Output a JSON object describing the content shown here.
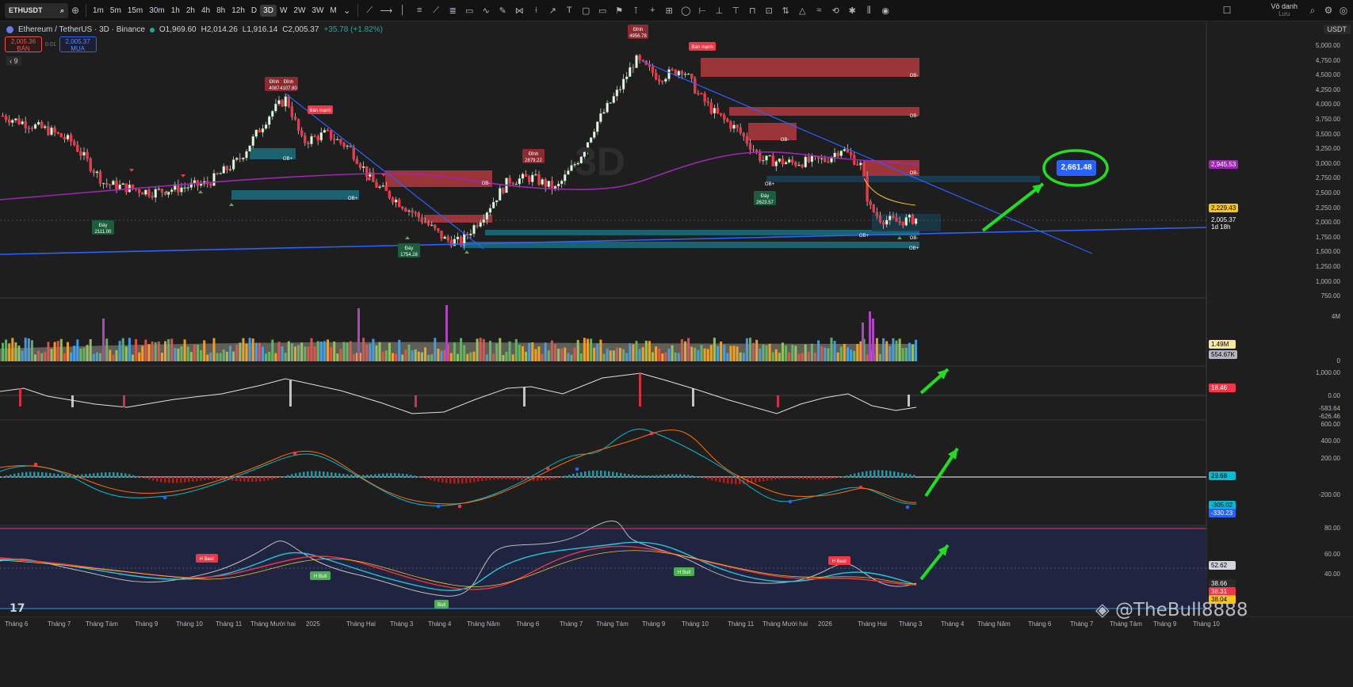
{
  "toolbar": {
    "symbol": "ETHUSDT",
    "intervals": [
      "1m",
      "5m",
      "15m",
      "30m",
      "1h",
      "2h",
      "4h",
      "8h",
      "12h",
      "D",
      "3D",
      "W",
      "2W",
      "3W",
      "M"
    ],
    "active_interval": "3D",
    "layout_name": "Vô danh",
    "layout_sub": "Lưu"
  },
  "legend": {
    "title": "Ethereum / TetherUS · 3D · Binance",
    "open": "O1,969.60",
    "high": "H2,014.26",
    "low": "L1,916.14",
    "close": "C2,005.37",
    "change": "+35.78 (+1.82%)"
  },
  "bidask": {
    "sell_price": "2,005.36",
    "sell_label": "BÁN",
    "spread": "0.01",
    "buy_price": "2,005.37",
    "buy_label": "MUA"
  },
  "indicator_count": "9",
  "currency": "USDT",
  "timeframe_watermark": "3D",
  "target_price": "2,661.48",
  "price_scale": [
    "5,000.00",
    "4,750.00",
    "4,500.00",
    "4,250.00",
    "4,000.00",
    "3,750.00",
    "3,500.00",
    "3,250.00",
    "3,000.00",
    "2,750.00",
    "2,500.00",
    "2,250.00",
    "2,000.00",
    "1,750.00",
    "1,500.00",
    "1,250.00",
    "1,000.00",
    "750.00"
  ],
  "price_tags": {
    "ma": "2,945.53",
    "ema": "2,229.43",
    "last": "2,005.37",
    "countdown": "1d 18h"
  },
  "volume_scale": [
    "4M",
    "0"
  ],
  "volume_tags": [
    "1.49M",
    "554.67K"
  ],
  "osc1_scale": [
    "1,000.00",
    "0.00",
    "-583.64",
    "-626.46"
  ],
  "osc1_tag": "18.46",
  "macd_scale": [
    "600.00",
    "400.00",
    "200.00",
    "-200.00",
    "-305.02",
    "-330.23"
  ],
  "macd_tag": "29.68",
  "rsi_scale": [
    "80.00",
    "60.00",
    "52.62",
    "40.00",
    "38.66",
    "38.31",
    "38.04"
  ],
  "chart_labels": {
    "peak1": "Đỉnh\n4087",
    "peak2": "Đỉnh\n4107.80",
    "peak3": "Đỉnh\n4956.78",
    "peak4": "Đỉnh\n2879.22",
    "trough1": "Đáy\n2111.00",
    "trough2": "Đáy\n1754.28",
    "trough3": "Đáy\n2623.57",
    "strong_sell": "Bán mạnh",
    "ob_bull": "OB+",
    "ob_bear": "OB-",
    "h_bear": "H Bear",
    "h_bull": "H Bull",
    "bull": "Bull"
  },
  "months": [
    "Tháng 6",
    "Tháng 7",
    "Tháng Tám",
    "Tháng 9",
    "Tháng 10",
    "Tháng 11",
    "Tháng Mười hai",
    "2025",
    "Tháng Hai",
    "Tháng 3",
    "Tháng 4",
    "Tháng Năm",
    "Tháng 6",
    "Tháng 7",
    "Tháng Tám",
    "Tháng 9",
    "Tháng 10",
    "Tháng 11",
    "Tháng Mười hai",
    "2026",
    "Tháng Hai",
    "Tháng 3",
    "Tháng 4",
    "Tháng Năm",
    "Tháng 6",
    "Tháng 7",
    "Tháng Tám",
    "Tháng 9",
    "Tháng 10"
  ],
  "watermark": "@TheBull8888",
  "tv_logo": "17",
  "colors": {
    "bull": "#4caf50",
    "bear": "#f23645",
    "ob_bear": "#b2393f",
    "ob_bull": "#1b6f80",
    "trend_line": "#2962ff",
    "ma": "#9c27b0",
    "arrow": "#22dd22"
  }
}
